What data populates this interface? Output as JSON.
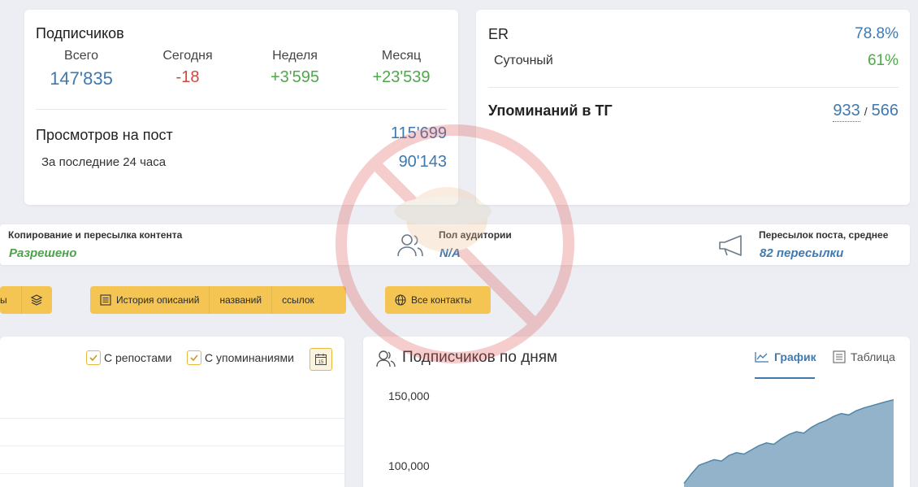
{
  "subscribers": {
    "title": "Подписчиков",
    "stats": [
      {
        "label": "Всего",
        "value": "147'835",
        "color": "#3f79ae"
      },
      {
        "label": "Сегодня",
        "value": "-18",
        "color": "#d1473f"
      },
      {
        "label": "Неделя",
        "value": "+3'595",
        "color": "#4fa84a"
      },
      {
        "label": "Месяц",
        "value": "+23'539",
        "color": "#4fa84a"
      }
    ],
    "views_title": "Просмотров на пост",
    "views_value": "115'699",
    "views_24h_label": "За последние 24 часа",
    "views_24h_value": "90'143"
  },
  "er": {
    "title": "ER",
    "value": "78.8%",
    "daily_label": "Суточный",
    "daily_value": "61%",
    "mentions_title": "Упоминаний в ТГ",
    "mentions_a": "933",
    "mentions_sep": "/",
    "mentions_b": "566"
  },
  "info": {
    "copy_label": "Копирование и пересылка контента",
    "copy_value": "Разрешено",
    "gender_label": "Пол аудитории",
    "gender_value": "N/A",
    "forwards_label": "Пересылок поста, среднее",
    "forwards_value": "82 пересылки"
  },
  "buttons": {
    "partial_label": "ы",
    "history": "История описаний",
    "names": "названий",
    "links": "ссылок",
    "contacts": "Все контакты"
  },
  "posts_card": {
    "reposts": "С репостами",
    "mentions": "С упоминаниями",
    "calendar_day": "15"
  },
  "chart": {
    "title": "Подписчиков по дням",
    "tab_graph": "График",
    "tab_table": "Таблица"
  },
  "chart_data": {
    "type": "area",
    "title": "",
    "yticks": [
      "150,000",
      "100,000"
    ],
    "ylim": [
      100000,
      150000
    ],
    "series": [
      {
        "values": [
          88000,
          95000,
          101000,
          103000,
          105000,
          104000,
          108000,
          110000,
          109000,
          112000,
          115000,
          117000,
          116000,
          120000,
          123000,
          125000,
          124000,
          128000,
          131000,
          133000,
          136000,
          138000,
          137000,
          140000,
          142000,
          143500,
          145000,
          146500,
          147835
        ]
      }
    ],
    "color": "#7fa6c0"
  },
  "colors": {
    "accent_blue": "#3f79ae",
    "green": "#4fa84a",
    "red": "#d1473f",
    "button": "#f4c552"
  }
}
